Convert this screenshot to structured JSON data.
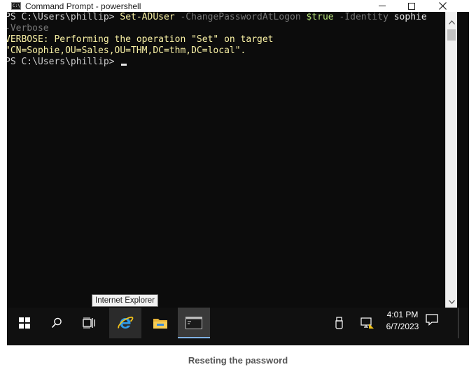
{
  "window": {
    "title": "Command Prompt - powershell",
    "icon": "cmd-window-icon",
    "minimize_icon": "minimize-icon",
    "maximize_icon": "maximize-icon",
    "close_icon": "close-icon"
  },
  "console": {
    "line1": {
      "prompt": "PS C:\\Users\\phillip> ",
      "cmdlet": "Set-ADUser",
      "param1": " -ChangePasswordAtLogon ",
      "value1": "$true",
      "param2": " -Identity ",
      "value2": "sophie"
    },
    "line2": {
      "param3": "-Verbose"
    },
    "line3": "VERBOSE: Performing the operation \"Set\" on target",
    "line4": "\"CN=Sophie,OU=Sales,OU=THM,DC=thm,DC=local\".",
    "line5": {
      "prompt": "PS C:\\Users\\phillip> "
    }
  },
  "taskbar": {
    "start_icon": "windows-start-icon",
    "search_icon": "search-icon",
    "taskview_icon": "task-view-icon",
    "ie_icon": "internet-explorer-icon",
    "explorer_icon": "file-explorer-icon",
    "cmd_icon": "command-prompt-icon",
    "tooltip": "Internet Explorer",
    "clock_time": "4:01 PM",
    "clock_date": "6/7/2023"
  },
  "caption": "Reseting the password",
  "colors": {
    "console_bg": "#0c0c0c",
    "console_text": "#cccccc",
    "cmdlet_yellow": "#f9f1a5",
    "param_gray": "#767676",
    "variable_green": "#b6e07a",
    "taskbar_bg": "#101010"
  }
}
